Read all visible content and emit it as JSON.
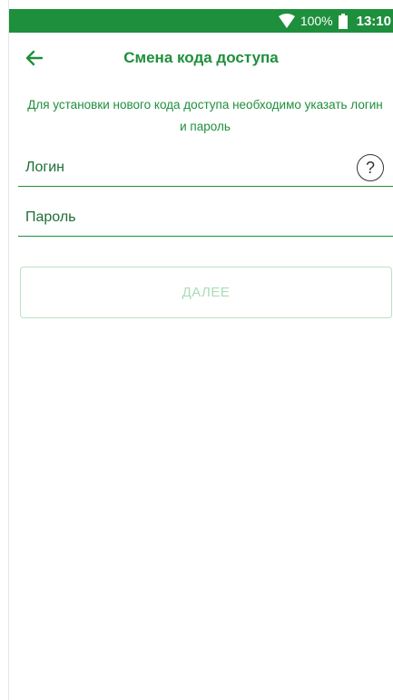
{
  "status_bar": {
    "wifi_icon": "wifi-icon",
    "battery_percent": "100%",
    "battery_icon": "battery-full-icon",
    "time": "13:10"
  },
  "app_bar": {
    "back_icon": "arrow-left-icon",
    "title": "Смена кода доступа"
  },
  "description": "Для установки нового кода доступа необходимо указать логин и пароль",
  "form": {
    "login": {
      "placeholder": "Логин",
      "value": "",
      "help_icon": "help-circle-icon",
      "help_label": "?"
    },
    "password": {
      "placeholder": "Пароль",
      "value": ""
    },
    "next_button_label": "ДАЛЕЕ"
  },
  "colors": {
    "primary": "#1e8f3c",
    "button_disabled_text": "#a9dcb7",
    "button_disabled_border": "#b8e2c4"
  }
}
